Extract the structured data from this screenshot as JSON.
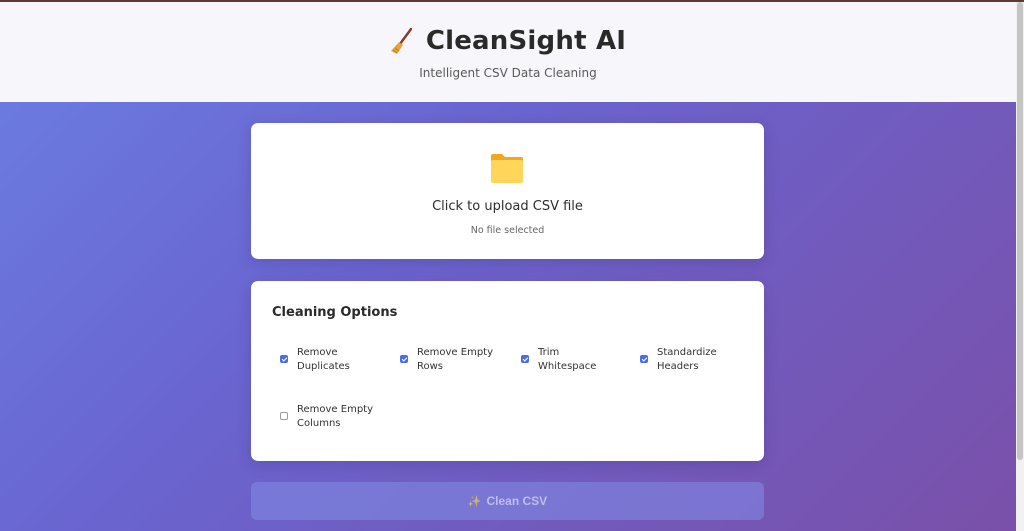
{
  "header": {
    "title": "CleanSight AI",
    "subtitle": "Intelligent CSV Data Cleaning",
    "icon": "broom-icon"
  },
  "upload": {
    "icon": "folder-icon",
    "label": "Click to upload CSV file",
    "status": "No file selected"
  },
  "options": {
    "title": "Cleaning Options",
    "items": [
      {
        "label_line1": "Remove",
        "label_line2": "Duplicates",
        "checked": true
      },
      {
        "label_line1": "Remove Empty",
        "label_line2": "Rows",
        "checked": true
      },
      {
        "label_line1": "Trim",
        "label_line2": "Whitespace",
        "checked": true
      },
      {
        "label_line1": "Standardize",
        "label_line2": "Headers",
        "checked": true
      },
      {
        "label_line1": "Remove Empty",
        "label_line2": "Columns",
        "checked": false
      }
    ]
  },
  "action": {
    "icon": "sparkle-icon",
    "label": "Clean CSV"
  },
  "colors": {
    "accent": "#4a6ee0",
    "gradient_start": "#6b7fe3",
    "gradient_end": "#7a50a9"
  }
}
